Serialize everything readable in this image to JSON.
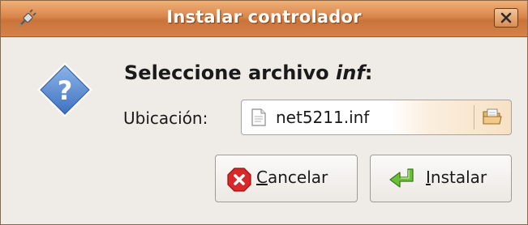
{
  "window": {
    "title": "Instalar controlador",
    "title_icon": "device-plug-icon",
    "close_icon": "close-icon",
    "accent_color": "#d9864b"
  },
  "dialog": {
    "icon": "question-icon",
    "heading_prefix": "Seleccione archivo ",
    "heading_emphasis": "inf",
    "heading_suffix": ":",
    "location_label": "Ubicación:",
    "file_chooser": {
      "value": "net5211.inf",
      "file_icon": "document-icon",
      "open_icon": "open-folder-icon"
    }
  },
  "buttons": {
    "cancel": {
      "mnemonic": "C",
      "rest": "ancelar",
      "icon": "cancel-icon"
    },
    "install": {
      "mnemonic": "I",
      "rest": "nstalar",
      "icon": "apply-arrow-icon"
    }
  }
}
